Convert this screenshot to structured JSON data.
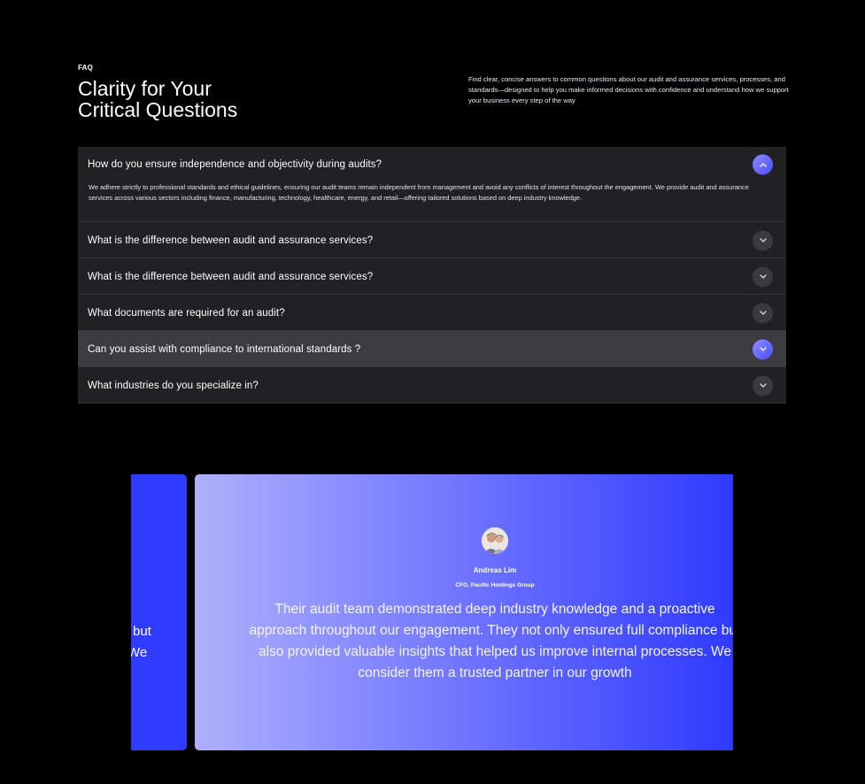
{
  "header": {
    "eyebrow": "FAQ",
    "title_line1": "Clarity for Your",
    "title_line2": "Critical Questions",
    "intro": "Find clear, concise answers to common questions about our audit and assurance services, processes, and standards—designed to help you make informed decisions with confidence and understand how we support your business every step of the way"
  },
  "faq": {
    "items": [
      {
        "question": "How do you ensure independence and objectivity during audits?",
        "answer": "We adhere strictly to professional standards and ethical guidelines, ensuring our audit teams remain independent from management and avoid any conflicts of interest throughout the engagement. We provide audit and assurance services across various sectors including finance, manufacturing, technology, healthcare, energy, and retail—offering tailored solutions based on deep industry knowledge.",
        "state": "open"
      },
      {
        "question": "What is the difference between audit and assurance services?",
        "state": "closed"
      },
      {
        "question": "What is the difference between audit and assurance services?",
        "state": "closed"
      },
      {
        "question": "What documents are required for an audit?",
        "state": "closed"
      },
      {
        "question": "Can you assist with compliance to international standards ?",
        "state": "hover"
      },
      {
        "question": "What industries do you specialize in?",
        "state": "closed"
      }
    ]
  },
  "testimonials": {
    "previous_card": {
      "line1": "but",
      "line2": "We"
    },
    "active": {
      "name": "Andreas Lim",
      "role": "CFO, Pacific Holdings Group",
      "quote_line1": "Their audit team demonstrated deep industry knowledge and a proactive",
      "quote_line2": "approach throughout our engagement. They not only ensured full compliance but",
      "quote_line3": "also provided valuable insights that helped us improve internal processes. We",
      "quote_line4": "consider them a trusted partner in our growth"
    }
  },
  "colors": {
    "accent": "#4a4cff",
    "card_dark": "#212124",
    "card_hover": "#3c3c40",
    "testimonial_blue": "#2e3aff"
  }
}
